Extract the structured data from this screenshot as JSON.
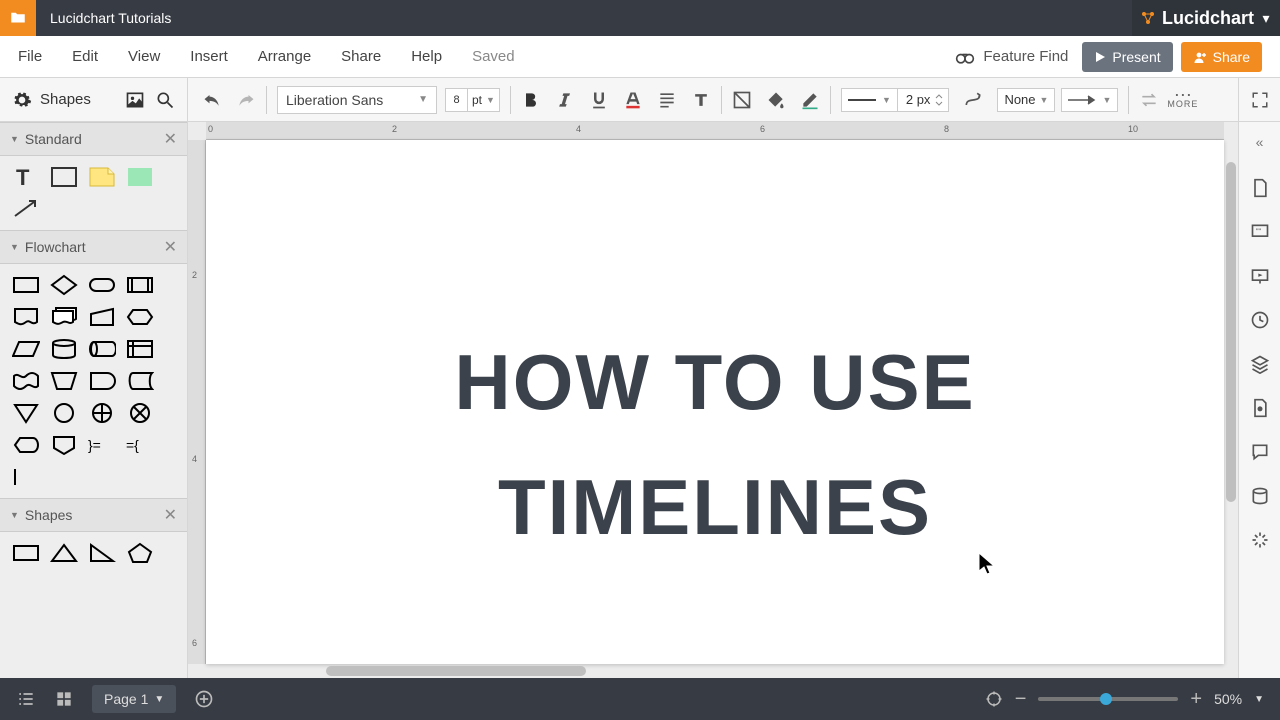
{
  "titlebar": {
    "doc_name": "Lucidchart Tutorials",
    "brand": "Lucidchart"
  },
  "menu": {
    "items": [
      "File",
      "Edit",
      "View",
      "Insert",
      "Arrange",
      "Share",
      "Help"
    ],
    "status": "Saved",
    "feature_find": "Feature Find",
    "present": "Present",
    "share": "Share"
  },
  "toolbar": {
    "shapes_label": "Shapes",
    "font": "Liberation Sans",
    "font_size": "8",
    "font_unit": "pt",
    "line_width": "2 px",
    "endpoint_left": "None",
    "more": "MORE"
  },
  "palettes": {
    "p0": {
      "name": "Standard"
    },
    "p1": {
      "name": "Flowchart"
    },
    "p2": {
      "name": "Shapes"
    }
  },
  "canvas": {
    "title_line1": "HOW TO USE",
    "title_line2": "TIMELINES"
  },
  "ruler": {
    "h": [
      "0",
      "2",
      "4",
      "6",
      "8",
      "10"
    ],
    "v": [
      "2",
      "4",
      "6"
    ]
  },
  "bottombar": {
    "page": "Page 1",
    "zoom": "50%"
  }
}
